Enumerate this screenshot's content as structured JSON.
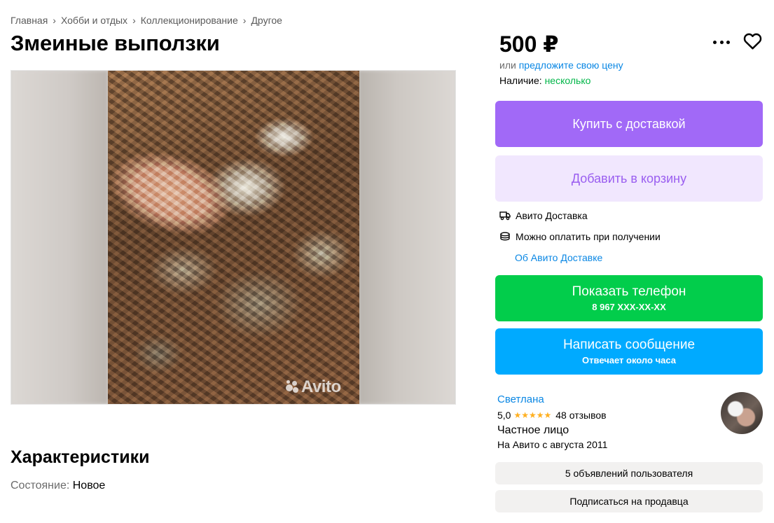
{
  "breadcrumb": [
    "Главная",
    "Хобби и отдых",
    "Коллекционирование",
    "Другое"
  ],
  "breadcrumb_separator": "›",
  "title": "Змеиные выползки",
  "gallery": {
    "watermark": "Avito"
  },
  "characteristics": {
    "heading": "Характеристики",
    "condition_label": "Состояние: ",
    "condition_value": "Новое"
  },
  "price": "500 ₽",
  "offer": {
    "prefix": "или ",
    "link": "предложите свою цену"
  },
  "availability": {
    "label": "Наличие: ",
    "value": "несколько"
  },
  "buttons": {
    "buy": "Купить с доставкой",
    "cart": "Добавить в корзину",
    "phone": "Показать телефон",
    "phone_number": "8 967 XXX-XX-XX",
    "message": "Написать сообщение",
    "message_sub": "Отвечает около часа"
  },
  "delivery": {
    "line1": "Авито Доставка",
    "line2": "Можно оплатить при получении",
    "link": "Об Авито Доставке"
  },
  "seller": {
    "name": "Светлана",
    "rating": "5,0",
    "stars": "★★★★★",
    "reviews": "48 отзывов",
    "type": "Частное лицо",
    "since": "На Авито с августа 2011"
  },
  "seller_actions": {
    "listings": "5 объявлений пользователя",
    "subscribe": "Подписаться на продавца"
  },
  "colors": {
    "buy": "#a169f7",
    "cart_bg": "#f1e7fe",
    "phone": "#02cd4b",
    "message": "#00aaff",
    "link": "#0a87e4",
    "availability": "#02b649",
    "star": "#ffb021"
  }
}
